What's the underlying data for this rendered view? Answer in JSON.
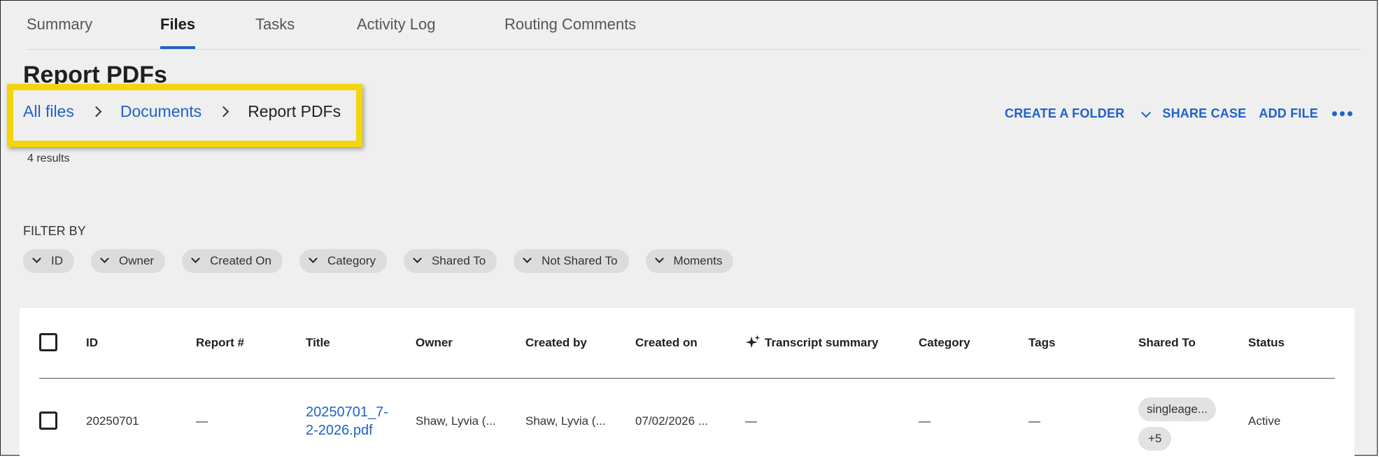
{
  "tabs": [
    {
      "label": "Summary",
      "active": false
    },
    {
      "label": "Files",
      "active": true
    },
    {
      "label": "Tasks",
      "active": false
    },
    {
      "label": "Activity Log",
      "active": false
    },
    {
      "label": "Routing Comments",
      "active": false
    }
  ],
  "page_title": "Report PDFs",
  "breadcrumb": [
    "All files",
    "Documents",
    "Report PDFs"
  ],
  "results": "4 results",
  "actions": {
    "create_folder": "CREATE A FOLDER",
    "share_case": "SHARE CASE",
    "add_file": "ADD FILE"
  },
  "filter_label": "FILTER BY",
  "filters": [
    "ID",
    "Owner",
    "Created On",
    "Category",
    "Shared To",
    "Not Shared To",
    "Moments"
  ],
  "table": {
    "columns": [
      "ID",
      "Report #",
      "Title",
      "Owner",
      "Created by",
      "Created on",
      "Transcript summary",
      "Category",
      "Tags",
      "Shared To",
      "Status"
    ],
    "rows": [
      {
        "id": "20250701",
        "report": "—",
        "title_line1": "20250701_7-",
        "title_line2": "2-2026.pdf",
        "owner": "Shaw, Lyvia (...",
        "created_by": "Shaw, Lyvia (...",
        "created_on": "07/02/2026 ...",
        "transcript": "—",
        "category": "—",
        "tags": "—",
        "shared_to": "singleage...",
        "shared_more": "+5",
        "status": "Active"
      }
    ]
  },
  "colors": {
    "accent": "#1f62c9",
    "highlight": "#f2d60a"
  }
}
